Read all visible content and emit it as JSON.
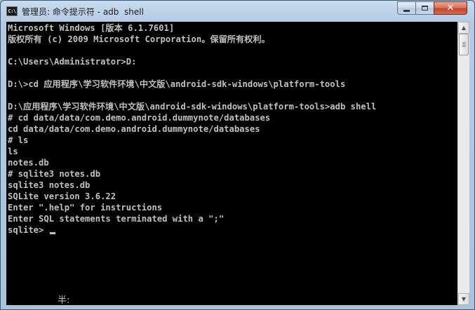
{
  "window": {
    "title": "管理员: 命令提示符 - adb  shell",
    "app_icon_label": "C:\\",
    "controls": {
      "minimize_icon": "minimize-icon",
      "maximize_icon": "maximize-icon",
      "close_glyph": "✕"
    }
  },
  "console": {
    "lines": [
      "Microsoft Windows [版本 6.1.7601]",
      "版权所有 (c) 2009 Microsoft Corporation。保留所有权利。",
      "",
      "C:\\Users\\Administrator>D:",
      "",
      "D:\\>cd 应用程序\\学习软件环境\\中文版\\android-sdk-windows\\platform-tools",
      "",
      "D:\\应用程序\\学习软件环境\\中文版\\android-sdk-windows\\platform-tools>adb shell",
      "# cd data/data/com.demo.android.dummynote/databases",
      "cd data/data/com.demo.android.dummynote/databases",
      "# ls",
      "ls",
      "notes.db",
      "# sqlite3 notes.db",
      "sqlite3 notes.db",
      "SQLite version 3.6.22",
      "Enter \".help\" for instructions",
      "Enter SQL statements terminated with a \";\"",
      "sqlite> "
    ],
    "ime_text": "半:",
    "colors": {
      "background": "#000000",
      "foreground": "#c0c0c0"
    }
  },
  "scrollbar": {
    "up_glyph": "▲",
    "down_glyph": "▼",
    "position_fraction": 0.0
  }
}
